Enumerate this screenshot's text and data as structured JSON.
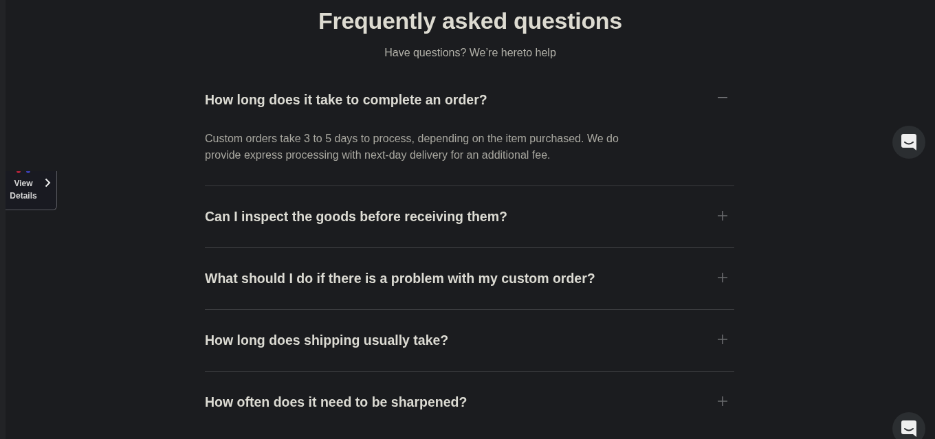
{
  "header": {
    "title": "Frequently asked questions",
    "subtitle": "Have questions? We’re hereto help"
  },
  "faq": [
    {
      "question": "How long does it take to complete an order?",
      "expanded": true,
      "answer": "Custom orders take 3 to 5 days to process, depending on the item purchased. We do provide express processing with next-day delivery for an additional fee."
    },
    {
      "question": "Can I inspect the goods before receiving them?",
      "expanded": false
    },
    {
      "question": "What should I do if there is a problem with my custom order?",
      "expanded": false
    },
    {
      "question": "How long does shipping usually take?",
      "expanded": false
    },
    {
      "question": "How often does it need to be sharpened?",
      "expanded": false
    }
  ],
  "side_tab": {
    "label": "View Details"
  }
}
